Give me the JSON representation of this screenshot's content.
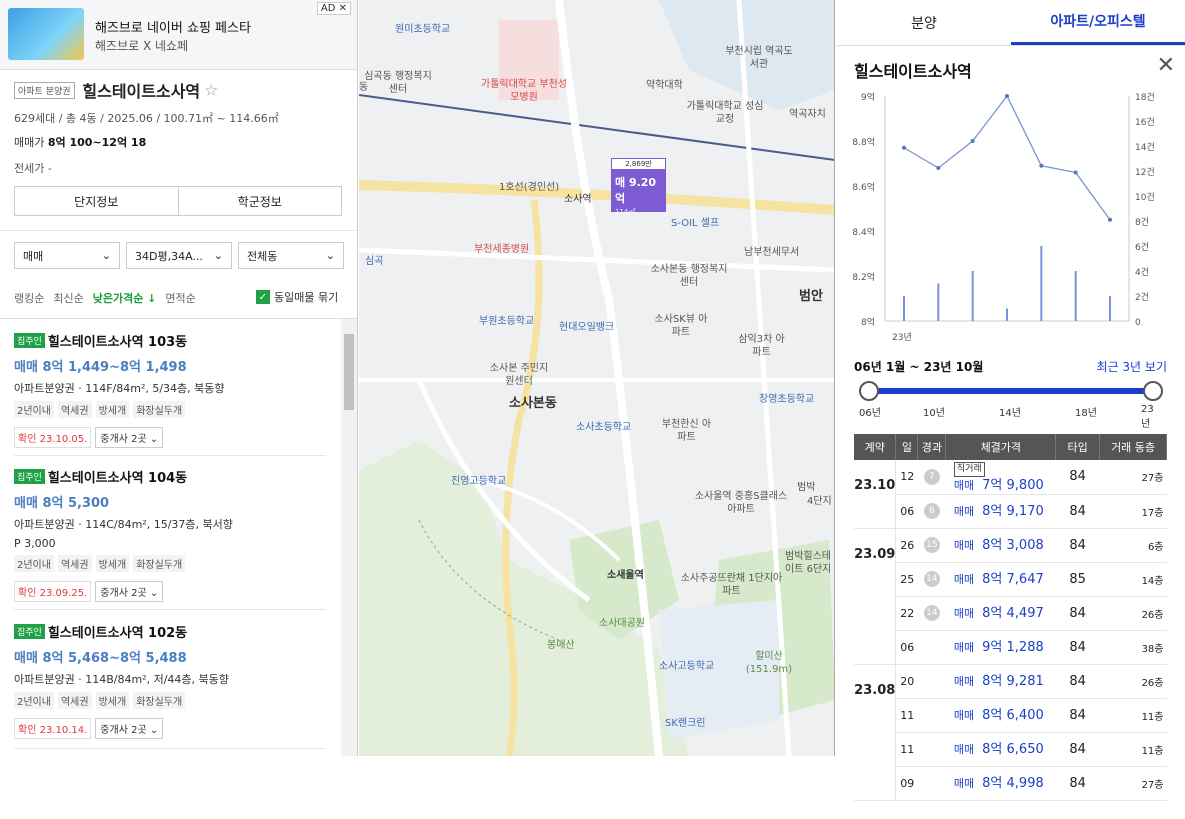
{
  "ad": {
    "title": "해즈브로 네이버 쇼핑 페스타",
    "sub": "해즈브로 X 네쇼페",
    "mark": "AD ✕"
  },
  "complex": {
    "badge": "아파트 분양권",
    "name": "힐스테이트소사역",
    "star": "☆",
    "meta": "629세대 / 총 4동 / 2025.06 / 100.71㎡ ~ 114.66㎡",
    "price_label": "매매가",
    "price_value": "8억 100~12억 18",
    "jeonse": "전세가 -"
  },
  "buttons": {
    "info": "단지정보",
    "school": "학군정보"
  },
  "filters": {
    "deal": "매매",
    "size": "34D평,34A...",
    "dong": "전체동"
  },
  "sorts": [
    "랭킹순",
    "최신순",
    "낮은가격순 ↓",
    "면적순"
  ],
  "group_checkbox": "동일매물 묶기",
  "listings": [
    {
      "owner": "집주인",
      "name": "힐스테이트소사역 103동",
      "price": "매매 8억 1,449~8억 1,498",
      "desc": "아파트분양권 · 114F/84m², 5/34층, 북동향",
      "extra": "",
      "tags": [
        "2년이내",
        "역세권",
        "방세개",
        "화장실두개"
      ],
      "confirm": "확인 23.10.05.",
      "agents": "중개사 2곳 ⌄"
    },
    {
      "owner": "집주인",
      "name": "힐스테이트소사역 104동",
      "price": "매매 8억 5,300",
      "desc": "아파트분양권 · 114C/84m², 15/37층, 북서향",
      "extra": "P 3,000",
      "tags": [
        "2년이내",
        "역세권",
        "방세개",
        "화장실두개"
      ],
      "confirm": "확인 23.09.25.",
      "agents": "중개사 2곳 ⌄"
    },
    {
      "owner": "집주인",
      "name": "힐스테이트소사역 102동",
      "price": "매매 8억 5,468~8억 5,488",
      "desc": "아파트분양권 · 114B/84m², 저/44층, 북동향",
      "extra": "",
      "tags": [
        "2년이내",
        "역세권",
        "방세개",
        "화장실두개"
      ],
      "confirm": "확인 23.10.14.",
      "agents": "중개사 2곳 ⌄"
    }
  ],
  "map": {
    "marker": {
      "top": "2,869만",
      "price": "매 9.20억",
      "area": "114㎡"
    },
    "labels": [
      "원미초등학교",
      "심곡동 행정복지센터",
      "가톨릭대학교 부천성모병원",
      "약학대학",
      "부천시립 역곡도서관",
      "가톨릭대학교 성심교정",
      "역곡자치",
      "1호선(경인선)",
      "소사역",
      "S-OIL 셀프",
      "부천세종병원",
      "남부천세무서",
      "소사본동 행정복지센터",
      "범안",
      "부원초등학교",
      "현대오일뱅크",
      "소사SK뷰 아파트",
      "삼익3차 아파트",
      "소사본 주민지원센터",
      "창영초등학교",
      "소사본동",
      "소사초등학교",
      "부천한신 아파트",
      "진영고등학교",
      "소새울역",
      "소사울역 중흥S클래스아파트",
      "소사주공뜨란채 1단지아파트",
      "범박힐스테이트 6단지",
      "소사대공원",
      "봉매산",
      "할미산 (151.9m)",
      "소사고등학교",
      "SK렌크린",
      "심곡",
      "동",
      "범박",
      "4단지"
    ]
  },
  "right": {
    "tabs": [
      "분양",
      "아파트/오피스텔"
    ],
    "title": "힐스테이트소사역",
    "period": "06년 1월 ~ 23년 10월",
    "recent": "최근 3년 보기",
    "slider_labels": [
      "06년",
      "10년",
      "14년",
      "18년",
      "23년"
    ],
    "table_headers": [
      "계약",
      "일",
      "경과",
      "체결가격",
      "타입",
      "거래 동층"
    ],
    "direct_label": "직거래",
    "rows": [
      {
        "ym": "23.10",
        "day": "12",
        "el": "7",
        "kind": "매매",
        "price": "7억 9,800",
        "type": "84",
        "floor": "27층",
        "direct": true
      },
      {
        "ym": "",
        "day": "06",
        "el": "6",
        "kind": "매매",
        "price": "8억 9,170",
        "type": "84",
        "floor": "17층",
        "direct": false
      },
      {
        "ym": "23.09",
        "day": "26",
        "el": "15",
        "kind": "매매",
        "price": "8억 3,008",
        "type": "84",
        "floor": "6층",
        "direct": false
      },
      {
        "ym": "",
        "day": "25",
        "el": "14",
        "kind": "매매",
        "price": "8억 7,647",
        "type": "85",
        "floor": "14층",
        "direct": false
      },
      {
        "ym": "",
        "day": "22",
        "el": "14",
        "kind": "매매",
        "price": "8억 4,497",
        "type": "84",
        "floor": "26층",
        "direct": false
      },
      {
        "ym": "",
        "day": "06",
        "el": "",
        "kind": "매매",
        "price": "9억 1,288",
        "type": "84",
        "floor": "38층",
        "direct": false
      },
      {
        "ym": "23.08",
        "day": "20",
        "el": "",
        "kind": "매매",
        "price": "8억 9,281",
        "type": "84",
        "floor": "26층",
        "direct": false
      },
      {
        "ym": "",
        "day": "11",
        "el": "",
        "kind": "매매",
        "price": "8억 6,400",
        "type": "84",
        "floor": "11층",
        "direct": false
      },
      {
        "ym": "",
        "day": "11",
        "el": "",
        "kind": "매매",
        "price": "8억 6,650",
        "type": "84",
        "floor": "11층",
        "direct": false
      },
      {
        "ym": "",
        "day": "09",
        "el": "",
        "kind": "매매",
        "price": "8억 4,998",
        "type": "84",
        "floor": "27층",
        "direct": false
      }
    ]
  },
  "chart_data": {
    "type": "line",
    "xlabel": "23년",
    "y_left_ticks": [
      "9억",
      "8.8억",
      "8.6억",
      "8.4억",
      "8.2억",
      "8억"
    ],
    "y_right_ticks": [
      "18건",
      "16건",
      "14건",
      "12건",
      "10건",
      "8건",
      "6건",
      "4건",
      "2건",
      "0"
    ],
    "ylim": [
      8.0,
      9.0
    ],
    "y2lim": [
      0,
      18
    ],
    "series": [
      {
        "values": [
          8.77,
          8.68,
          8.8,
          9.0,
          8.69,
          8.66,
          8.45
        ]
      },
      {
        "values": [
          2,
          3,
          4,
          1,
          6,
          4,
          2
        ]
      }
    ]
  }
}
